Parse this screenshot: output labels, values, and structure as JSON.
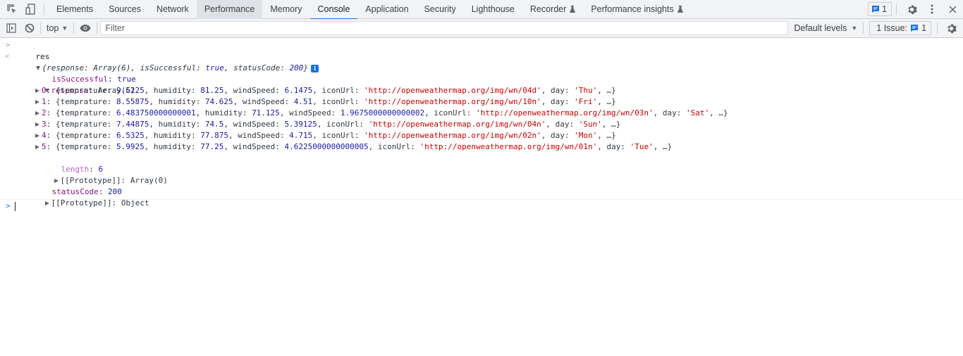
{
  "tabbar": {
    "tabs": [
      {
        "label": "Elements"
      },
      {
        "label": "Sources"
      },
      {
        "label": "Network"
      },
      {
        "label": "Performance",
        "hover": true
      },
      {
        "label": "Memory"
      },
      {
        "label": "Console",
        "active": true
      },
      {
        "label": "Application"
      },
      {
        "label": "Security"
      },
      {
        "label": "Lighthouse"
      },
      {
        "label": "Recorder",
        "experimental": true
      },
      {
        "label": "Performance insights",
        "experimental": true
      }
    ],
    "issues_count": "1"
  },
  "toolbar": {
    "context": "top",
    "filter_placeholder": "Filter",
    "filter_value": "",
    "levels": "Default levels",
    "issues_label": "1 Issue:",
    "issues_count": "1"
  },
  "console": {
    "command": "res",
    "summary": {
      "open": "{",
      "k1": "response",
      "v1": "Array(6)",
      "k2": "isSuccessful",
      "v2": "true",
      "k3": "statusCode",
      "v3": "200",
      "close": "}"
    },
    "isSuccessful": {
      "key": "isSuccessful",
      "value": "true"
    },
    "response": {
      "key": "response",
      "value": "Array(6)"
    },
    "items": [
      {
        "index": "0",
        "temprature": "9.5225",
        "humidity": "81.25",
        "windSpeed": "6.1475",
        "iconUrl": "'http://openweathermap.org/img/wn/04d'",
        "day": "'Thu'"
      },
      {
        "index": "1",
        "temprature": "8.55875",
        "humidity": "74.625",
        "windSpeed": "4.51",
        "iconUrl": "'http://openweathermap.org/img/wn/10n'",
        "day": "'Fri'"
      },
      {
        "index": "2",
        "temprature": "6.483750000000001",
        "humidity": "71.125",
        "windSpeed": "1.9675000000000002",
        "iconUrl": "'http://openweathermap.org/img/wn/03n'",
        "day": "'Sat'"
      },
      {
        "index": "3",
        "temprature": "7.44875",
        "humidity": "74.5",
        "windSpeed": "5.39125",
        "iconUrl": "'http://openweathermap.org/img/wn/04n'",
        "day": "'Sun'"
      },
      {
        "index": "4",
        "temprature": "6.5325",
        "humidity": "77.875",
        "windSpeed": "4.715",
        "iconUrl": "'http://openweathermap.org/img/wn/02n'",
        "day": "'Mon'"
      },
      {
        "index": "5",
        "temprature": "5.9925",
        "humidity": "77.25",
        "windSpeed": "4.6225000000000005",
        "iconUrl": "'http://openweathermap.org/img/wn/01n'",
        "day": "'Tue'"
      }
    ],
    "length": {
      "key": "length",
      "value": "6"
    },
    "array_proto": {
      "key": "[[Prototype]]",
      "value": "Array(0)"
    },
    "statusCode": {
      "key": "statusCode",
      "value": "200"
    },
    "object_proto": {
      "key": "[[Prototype]]",
      "value": "Object"
    }
  },
  "colors": {
    "accent": "#1a73e8",
    "key": "#881280",
    "number": "#1a1aa6",
    "string": "#c80000"
  }
}
